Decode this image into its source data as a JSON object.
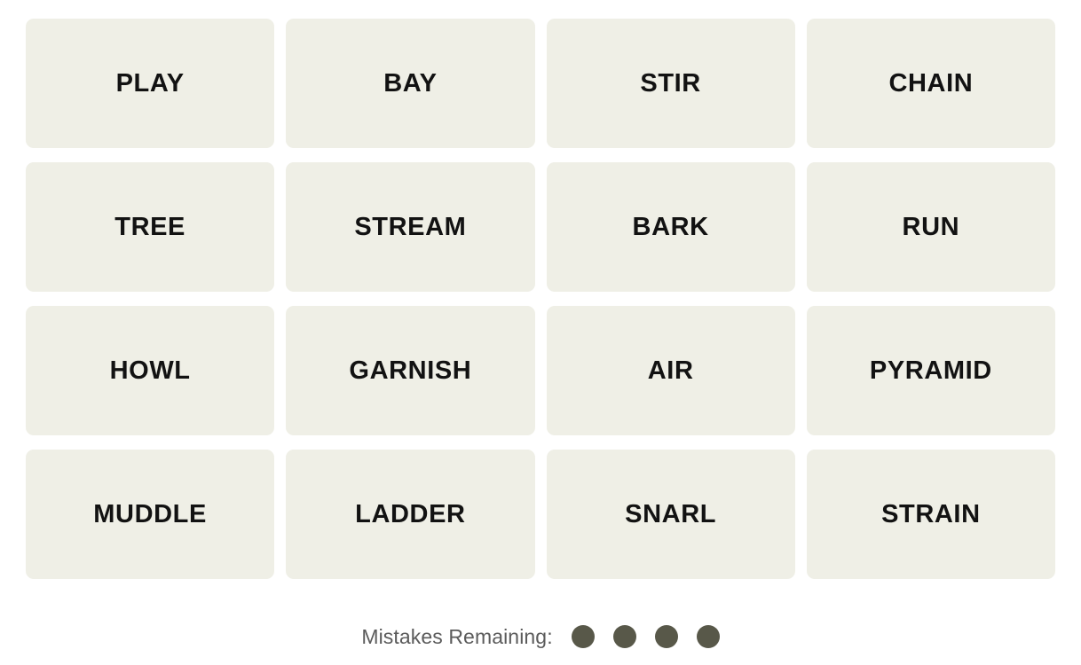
{
  "game": {
    "name": "Connections",
    "grid": {
      "rows": 4,
      "columns": 4,
      "tiles": [
        {
          "label": "PLAY",
          "row": 1,
          "column": 1
        },
        {
          "label": "BAY",
          "row": 1,
          "column": 2
        },
        {
          "label": "STIR",
          "row": 1,
          "column": 3
        },
        {
          "label": "CHAIN",
          "row": 1,
          "column": 4
        },
        {
          "label": "TREE",
          "row": 2,
          "column": 1
        },
        {
          "label": "STREAM",
          "row": 2,
          "column": 2
        },
        {
          "label": "BARK",
          "row": 2,
          "column": 3
        },
        {
          "label": "RUN",
          "row": 2,
          "column": 4
        },
        {
          "label": "HOWL",
          "row": 3,
          "column": 1
        },
        {
          "label": "GARNISH",
          "row": 3,
          "column": 2
        },
        {
          "label": "AIR",
          "row": 3,
          "column": 3
        },
        {
          "label": "PYRAMID",
          "row": 3,
          "column": 4
        },
        {
          "label": "MUDDLE",
          "row": 4,
          "column": 1
        },
        {
          "label": "LADDER",
          "row": 4,
          "column": 2
        },
        {
          "label": "SNARL",
          "row": 4,
          "column": 3
        },
        {
          "label": "STRAIN",
          "row": 4,
          "column": 4
        }
      ]
    },
    "mistakes": {
      "label": "Mistakes Remaining:",
      "remaining": 4,
      "dots": [
        {
          "state": "filled"
        },
        {
          "state": "filled"
        },
        {
          "state": "filled"
        },
        {
          "state": "filled"
        }
      ]
    }
  },
  "colors": {
    "page_background": "#ffffff",
    "tile_background": "#efefe6",
    "tile_text": "#121212",
    "mistakes_label_text": "#5b5b5b",
    "mistake_dot": "#585849"
  }
}
